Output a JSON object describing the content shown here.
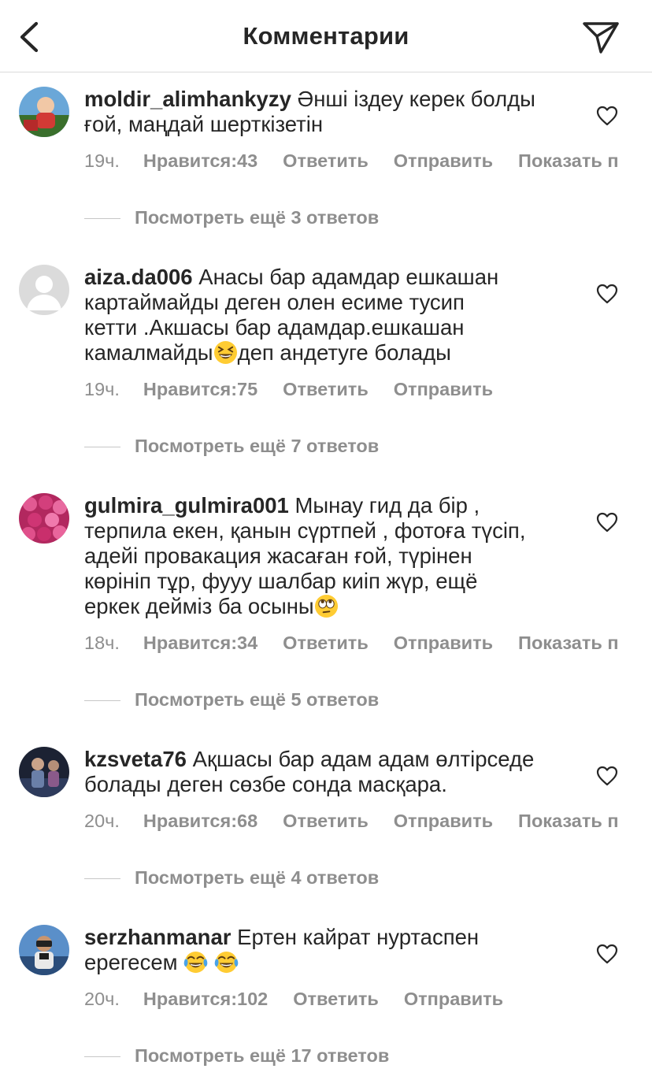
{
  "header": {
    "title": "Комментарии"
  },
  "actions": {
    "like_prefix": "Нравится: ",
    "reply": "Ответить",
    "send": "Отправить",
    "show": "Показать п"
  },
  "comments": [
    {
      "username": "moldir_alimhankyzy",
      "lines": [
        "Әнші іздеу керек болды",
        "ғой, маңдай шерткізетін"
      ],
      "time": "19ч.",
      "likes": "43",
      "show_translation": true,
      "replies_text": "Посмотреть ещё 3 ответов"
    },
    {
      "username": "aiza.da006",
      "lines": [
        "Анасы бар адамдар ешкашан",
        "картаймайды деген олен есиме тусип",
        "кетти .Акшасы бар адамдар.ешкашан",
        "камалмайды",
        "деп андетуге болады"
      ],
      "time": "19ч.",
      "likes": "75",
      "show_translation": false,
      "replies_text": "Посмотреть ещё 7 ответов"
    },
    {
      "username": "gulmira_gulmira001",
      "lines": [
        "Мынау гид да бір ,",
        "терпила екен, қанын сүртпей , фотоға түсіп,",
        "адейі провакация жасаған ғой, түрінен",
        "көрініп тұр, фууу  шалбар киіп жүр, ещё",
        "еркек дейміз ба осыны"
      ],
      "time": "18ч.",
      "likes": "34",
      "show_translation": true,
      "replies_text": "Посмотреть ещё 5 ответов"
    },
    {
      "username": "kzsveta76",
      "lines": [
        "Ақшасы бар адам адам өлтірседе",
        "болады деген сөзбе сонда масқара."
      ],
      "time": "20ч.",
      "likes": "68",
      "show_translation": true,
      "replies_text": "Посмотреть ещё 4 ответов"
    },
    {
      "username": "serzhanmanar",
      "lines": [
        "Ертен кайрат нуртаспен",
        "ерегесем"
      ],
      "time": "20ч.",
      "likes": "102",
      "show_translation": false,
      "replies_text": "Посмотреть ещё 17 ответов"
    }
  ],
  "icons": {
    "back": "chevron-left-icon",
    "send": "paper-plane-icon",
    "like": "heart-outline-icon",
    "emoji_grin": "grinning-squinting-face",
    "emoji_eyeroll": "face-with-rolling-eyes",
    "emoji_tears": "face-with-tears-of-joy"
  }
}
